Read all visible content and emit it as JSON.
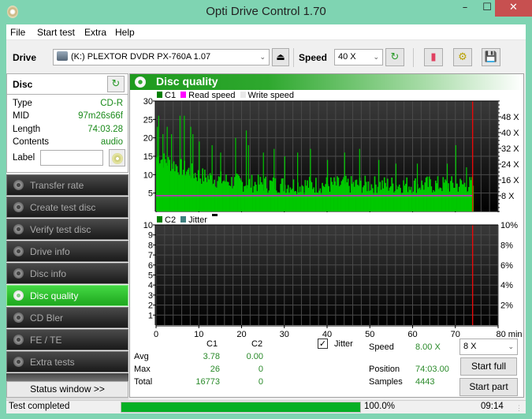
{
  "window": {
    "title": "Opti Drive Control 1.70",
    "minimize": "–",
    "maximize": "☐",
    "close": "✕"
  },
  "menu": [
    "File",
    "Start test",
    "Extra",
    "Help"
  ],
  "toolbar": {
    "drive_label": "Drive",
    "drive_value": "(K:)  PLEXTOR DVDR   PX-760A 1.07",
    "speed_label": "Speed",
    "speed_value": "40 X",
    "icons": [
      "eject-icon",
      "refresh-icon",
      "erase-icon",
      "settings-icon",
      "save-icon"
    ]
  },
  "disc": {
    "title": "Disc",
    "props": [
      {
        "label": "Type",
        "value": "CD-R"
      },
      {
        "label": "MID",
        "value": "97m26s66f"
      },
      {
        "label": "Length",
        "value": "74:03.28"
      },
      {
        "label": "Contents",
        "value": "audio"
      }
    ],
    "label_field": "Label",
    "label_value": ""
  },
  "nav": [
    {
      "label": "Transfer rate",
      "active": false
    },
    {
      "label": "Create test disc",
      "active": false
    },
    {
      "label": "Verify test disc",
      "active": false
    },
    {
      "label": "Drive info",
      "active": false
    },
    {
      "label": "Disc info",
      "active": false
    },
    {
      "label": "Disc quality",
      "active": true
    },
    {
      "label": "CD Bler",
      "active": false
    },
    {
      "label": "FE / TE",
      "active": false
    },
    {
      "label": "Extra tests",
      "active": false
    }
  ],
  "status_window_button": "Status window >>",
  "panel": {
    "title": "Disc quality"
  },
  "colors": {
    "c1": "#00c800",
    "c2": "#008000",
    "read_speed": "#ff00ff",
    "write_speed": "#e0e0e0",
    "jitter": "#408080",
    "end_marker": "#ff0000",
    "accent": "#1e9a1e"
  },
  "chart_data": [
    {
      "type": "bar",
      "title": "C1 / Read speed",
      "legend": [
        "C1",
        "Read speed",
        "Write speed"
      ],
      "legend_placement": "top-left",
      "xlabel": "min",
      "x_ticks": [
        "0",
        "10",
        "20",
        "30",
        "40",
        "50",
        "60",
        "70",
        "80 min"
      ],
      "xlim": [
        0,
        80
      ],
      "y_left_ticks": [
        "5",
        "10",
        "15",
        "20",
        "25",
        "30"
      ],
      "ylim": [
        0,
        30
      ],
      "y_right_ticks": [
        "8 X",
        "16 X",
        "24 X",
        "32 X",
        "40 X",
        "48 X"
      ],
      "y_right_lim": [
        0,
        56
      ],
      "grid": true,
      "end_marker_min": 74.05,
      "read_speed_x": 8,
      "c1_summary": {
        "avg": 3.78,
        "max": 26,
        "total": 16773
      },
      "c1_profile": [
        {
          "x": 0,
          "y": 14
        },
        {
          "x": 2,
          "y": 13
        },
        {
          "x": 4,
          "y": 12
        },
        {
          "x": 6,
          "y": 11
        },
        {
          "x": 8,
          "y": 10
        },
        {
          "x": 10,
          "y": 9
        },
        {
          "x": 14,
          "y": 8
        },
        {
          "x": 20,
          "y": 7
        },
        {
          "x": 30,
          "y": 6.5
        },
        {
          "x": 40,
          "y": 6.5
        },
        {
          "x": 50,
          "y": 6.5
        },
        {
          "x": 60,
          "y": 6.5
        },
        {
          "x": 74,
          "y": 6.5
        }
      ],
      "c1_peaks": [
        {
          "x": 0.2,
          "y": 23
        },
        {
          "x": 0.5,
          "y": 26
        },
        {
          "x": 1.5,
          "y": 21
        },
        {
          "x": 2.5,
          "y": 23
        },
        {
          "x": 3.5,
          "y": 21
        },
        {
          "x": 5.5,
          "y": 26
        },
        {
          "x": 6.5,
          "y": 26
        },
        {
          "x": 8.0,
          "y": 23
        },
        {
          "x": 8.5,
          "y": 21
        },
        {
          "x": 10.0,
          "y": 19
        },
        {
          "x": 13.0,
          "y": 18
        },
        {
          "x": 15.0,
          "y": 16
        },
        {
          "x": 18.5,
          "y": 20
        },
        {
          "x": 21.0,
          "y": 22
        },
        {
          "x": 21.5,
          "y": 18
        },
        {
          "x": 25.0,
          "y": 16
        },
        {
          "x": 27.5,
          "y": 17
        },
        {
          "x": 30.0,
          "y": 15
        },
        {
          "x": 33.0,
          "y": 16
        },
        {
          "x": 36.0,
          "y": 17
        },
        {
          "x": 40.0,
          "y": 14
        },
        {
          "x": 44.0,
          "y": 16
        },
        {
          "x": 47.5,
          "y": 17
        },
        {
          "x": 52.0,
          "y": 14
        },
        {
          "x": 56.0,
          "y": 13
        },
        {
          "x": 61.0,
          "y": 13
        },
        {
          "x": 68.0,
          "y": 13
        },
        {
          "x": 70.0,
          "y": 18
        },
        {
          "x": 72.5,
          "y": 12
        }
      ]
    },
    {
      "type": "bar",
      "title": "C2 / Jitter",
      "legend": [
        "C2",
        "Jitter"
      ],
      "legend_placement": "top-left",
      "xlabel": "min",
      "x_ticks": [
        "0",
        "10",
        "20",
        "30",
        "40",
        "50",
        "60",
        "70",
        "80 min"
      ],
      "xlim": [
        0,
        80
      ],
      "y_left_ticks": [
        "1",
        "2",
        "3",
        "4",
        "5",
        "6",
        "7",
        "8",
        "9",
        "10"
      ],
      "ylim": [
        0,
        10
      ],
      "y_right_ticks": [
        "2%",
        "4%",
        "6%",
        "8%",
        "10%"
      ],
      "y_right_lim": [
        0,
        10
      ],
      "grid": true,
      "end_marker_min": 74.05,
      "c2_summary": {
        "avg": 0.0,
        "max": 0,
        "total": 0
      }
    }
  ],
  "stats": {
    "col_c1": "C1",
    "col_c2": "C2",
    "rows": [
      {
        "label": "Avg",
        "c1": "3.78",
        "c2": "0.00"
      },
      {
        "label": "Max",
        "c1": "26",
        "c2": "0"
      },
      {
        "label": "Total",
        "c1": "16773",
        "c2": "0"
      }
    ],
    "jitter_label": "Jitter",
    "jitter_checked": true
  },
  "info": {
    "speed_label": "Speed",
    "speed_value": "8.00 X",
    "position_label": "Position",
    "position_value": "74:03.00",
    "samples_label": "Samples",
    "samples_value": "4443",
    "speed_select": "8 X",
    "start_full": "Start full",
    "start_part": "Start part"
  },
  "statusbar": {
    "text": "Test completed",
    "progress_percent": 100,
    "progress_text": "100.0%",
    "time": "09:14"
  }
}
